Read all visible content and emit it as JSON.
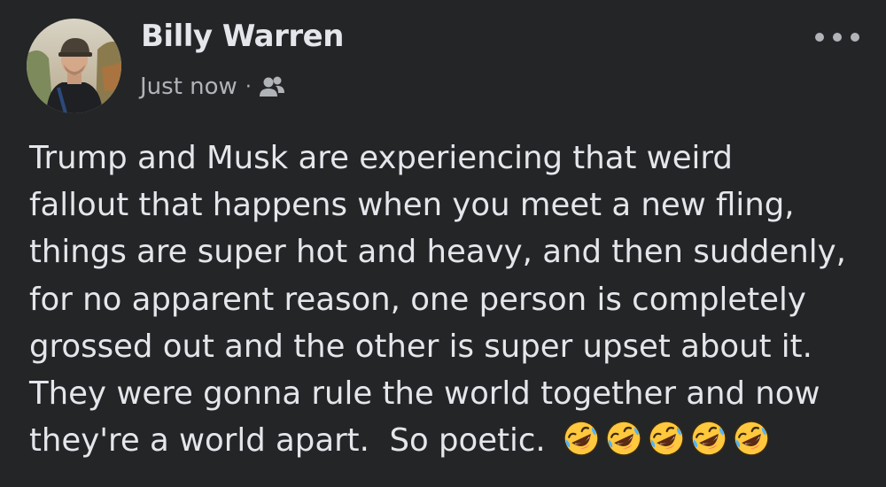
{
  "post": {
    "author": {
      "name": "Billy Warren",
      "avatar_icon": "profile-photo"
    },
    "meta": {
      "timestamp": "Just now",
      "separator": "·",
      "audience_icon": "friends-icon"
    },
    "more_icon": "more-options-icon",
    "text_lines": [
      "Trump and Musk are experiencing that weird",
      "fallout that happens when you meet a new fling,",
      "things are super hot and heavy, and then suddenly,",
      "for no apparent reason, one person is completely",
      "grossed out and the other is super upset about it.",
      "They were gonna rule the world together and now",
      "they're a world apart.  So poetic."
    ],
    "emoji": {
      "name": "rolling-on-the-floor-laughing",
      "count": 5
    }
  },
  "colors": {
    "background": "#242526",
    "primary_text": "#e4e6eb",
    "secondary_text": "#b0b3b8",
    "emoji_face": "#ffc83d",
    "emoji_tears": "#4fb3ff"
  }
}
